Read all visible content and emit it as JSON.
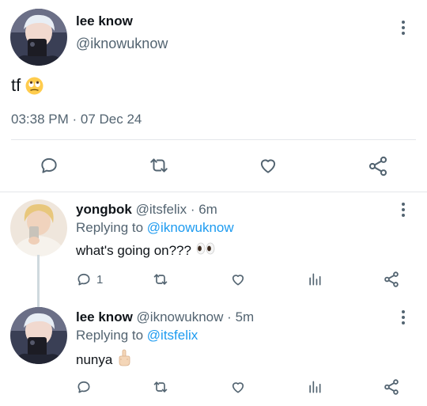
{
  "main_tweet": {
    "name": "lee know",
    "handle": "@iknowuknow",
    "text": "tf",
    "emoji": "face-with-rolling-eyes",
    "timestamp": "03:38 PM · 07 Dec 24",
    "actions": [
      "reply",
      "retweet",
      "like",
      "share"
    ]
  },
  "replies": [
    {
      "name": "yongbok",
      "handle": "@itsfelix",
      "time": "6m",
      "replying_label": "Replying to",
      "replying_to": "@iknowuknow",
      "text": "what's going on???",
      "emoji": "eyes",
      "reply_count": "1"
    },
    {
      "name": "lee know",
      "handle": "@iknowuknow",
      "time": "5m",
      "replying_label": "Replying to",
      "replying_to": "@itsfelix",
      "text": "nunya",
      "emoji": "middle-finger",
      "reply_count": ""
    }
  ],
  "colors": {
    "link": "#1d9bf0",
    "muted": "#536471",
    "divider": "#e4e7ea"
  }
}
